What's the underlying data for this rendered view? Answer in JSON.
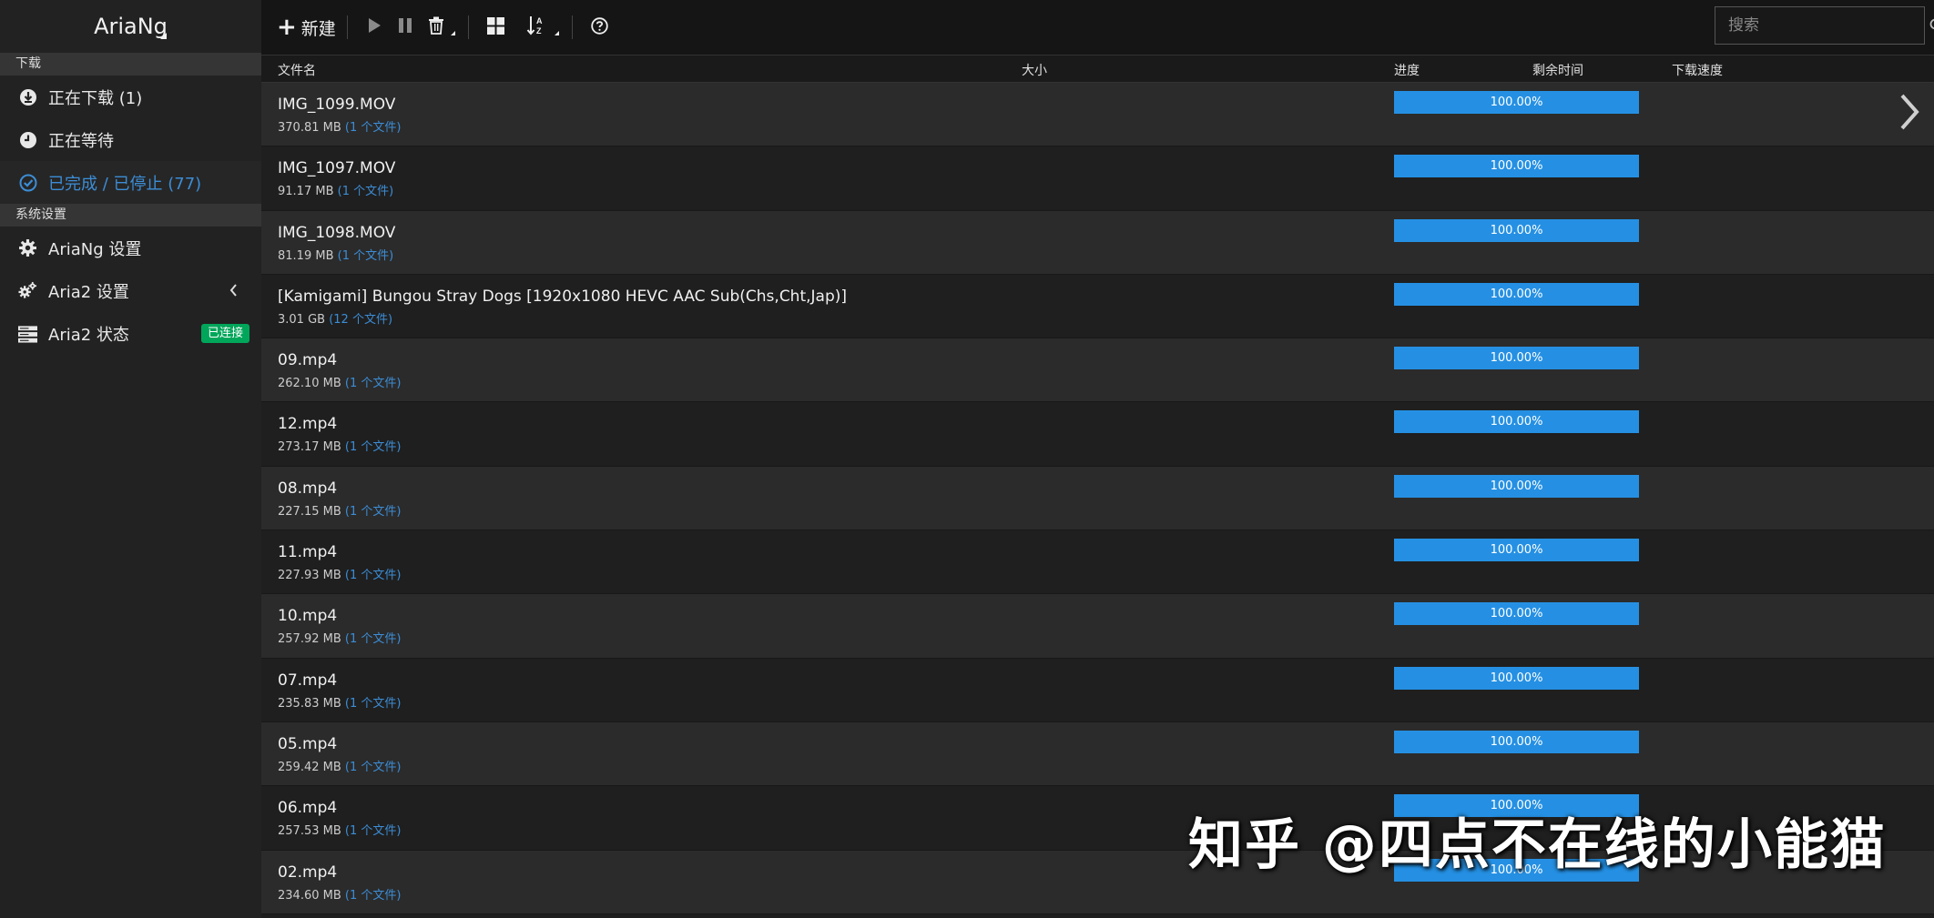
{
  "app": {
    "title": "AriaNg"
  },
  "sidebar": {
    "download_section": "下载",
    "settings_section": "系统设置",
    "items": [
      {
        "label": "正在下载 (1)",
        "icon": "download-circle-icon"
      },
      {
        "label": "正在等待",
        "icon": "clock-icon"
      },
      {
        "label": "已完成 / 已停止 (77)",
        "icon": "check-circle-icon"
      },
      {
        "label": "AriaNg 设置",
        "icon": "gear-icon"
      },
      {
        "label": "Aria2 设置",
        "icon": "gears-icon"
      },
      {
        "label": "Aria2 状态",
        "icon": "server-icon",
        "badge": "已连接"
      }
    ]
  },
  "toolbar": {
    "new_label": "新建",
    "search_placeholder": "搜索"
  },
  "table": {
    "headers": {
      "name": "文件名",
      "size": "大小",
      "progress": "进度",
      "remaining": "剩余时间",
      "speed": "下载速度"
    },
    "rows": [
      {
        "name": "IMG_1099.MOV",
        "size": "370.81 MB",
        "files": "(1 个文件)",
        "progress": "100.00%",
        "progress_value": 1.0
      },
      {
        "name": "IMG_1097.MOV",
        "size": "91.17 MB",
        "files": "(1 个文件)",
        "progress": "100.00%",
        "progress_value": 1.0
      },
      {
        "name": "IMG_1098.MOV",
        "size": "81.19 MB",
        "files": "(1 个文件)",
        "progress": "100.00%",
        "progress_value": 1.0
      },
      {
        "name": "[Kamigami] Bungou Stray Dogs [1920x1080 HEVC AAC Sub(Chs,Cht,Jap)]",
        "size": "3.01 GB",
        "files": "(12 个文件)",
        "progress": "100.00%",
        "progress_value": 1.0
      },
      {
        "name": "09.mp4",
        "size": "262.10 MB",
        "files": "(1 个文件)",
        "progress": "100.00%",
        "progress_value": 1.0
      },
      {
        "name": "12.mp4",
        "size": "273.17 MB",
        "files": "(1 个文件)",
        "progress": "100.00%",
        "progress_value": 1.0
      },
      {
        "name": "08.mp4",
        "size": "227.15 MB",
        "files": "(1 个文件)",
        "progress": "100.00%",
        "progress_value": 1.0
      },
      {
        "name": "11.mp4",
        "size": "227.93 MB",
        "files": "(1 个文件)",
        "progress": "100.00%",
        "progress_value": 1.0
      },
      {
        "name": "10.mp4",
        "size": "257.92 MB",
        "files": "(1 个文件)",
        "progress": "100.00%",
        "progress_value": 1.0
      },
      {
        "name": "07.mp4",
        "size": "235.83 MB",
        "files": "(1 个文件)",
        "progress": "100.00%",
        "progress_value": 1.0
      },
      {
        "name": "05.mp4",
        "size": "259.42 MB",
        "files": "(1 个文件)",
        "progress": "100.00%",
        "progress_value": 1.0
      },
      {
        "name": "06.mp4",
        "size": "257.53 MB",
        "files": "(1 个文件)",
        "progress": "100.00%",
        "progress_value": 1.0
      },
      {
        "name": "02.mp4",
        "size": "234.60 MB",
        "files": "(1 个文件)",
        "progress": "100.00%",
        "progress_value": 1.0
      }
    ]
  },
  "watermark": "知乎 @四点不在线的小能猫",
  "colors": {
    "accent": "#3c8dd6",
    "progress": "#2590e3",
    "badge": "#00a65a"
  }
}
